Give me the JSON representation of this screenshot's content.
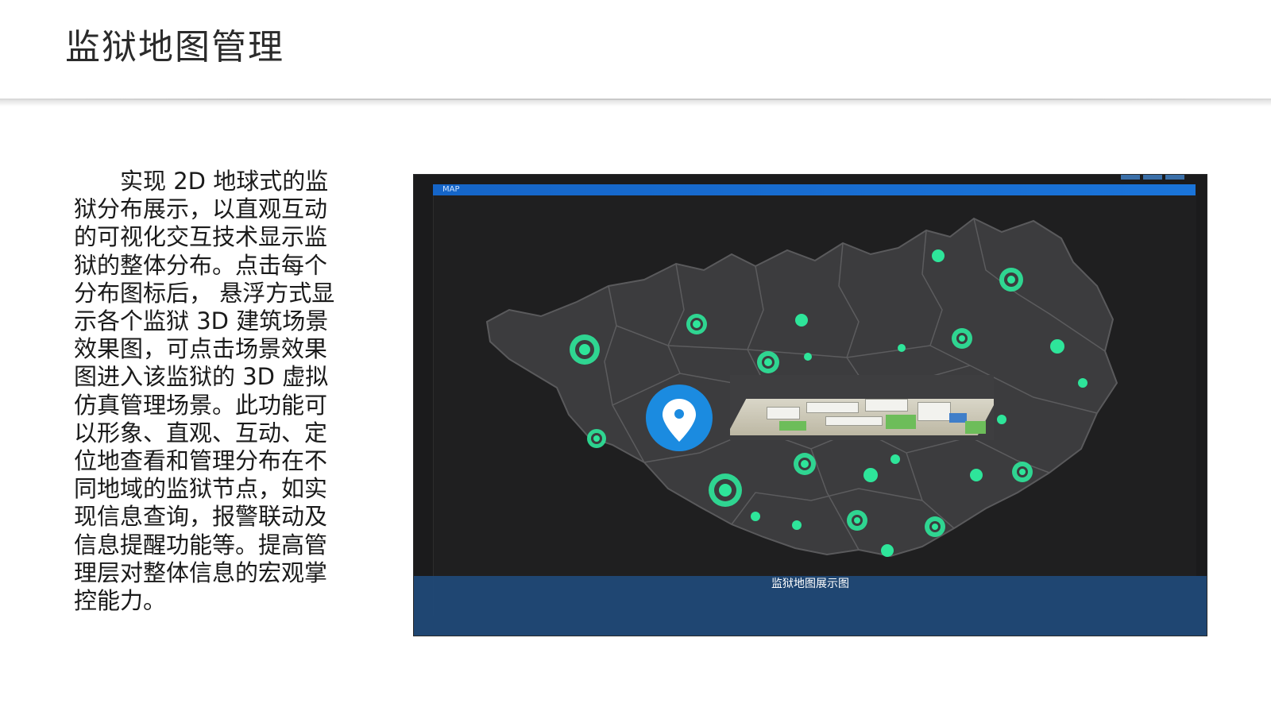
{
  "slide": {
    "title": "监狱地图管理",
    "description": "实现 2D 地球式的监狱分布展示，以直观互动的可视化交互技术显示监狱的整体分布。点击每个分布图标后， 悬浮方式显示各个监狱 3D 建筑场景效果图，可点击场景效果图进入该监狱的 3D 虚拟仿真管理场景。此功能可以形象、直观、互动、定位地查看和管理分布在不同地域的监狱节点，如实现信息查询，报警联动及信息提醒功能等。提高管理层对整体信息的宏观掌控能力。"
  },
  "map_panel": {
    "header_label": "MAP",
    "caption": "监狱地图展示图",
    "icons": {
      "pin": "location-pin-icon",
      "node": "prison-node-marker",
      "popup": "3d-building-scene"
    },
    "colors": {
      "header_blue": "#1a6fd6",
      "node_green": "#2ee59a",
      "pin_blue": "#1b8be0",
      "region_fill": "#3c3c3e",
      "caption_band": "#204a7a"
    }
  }
}
